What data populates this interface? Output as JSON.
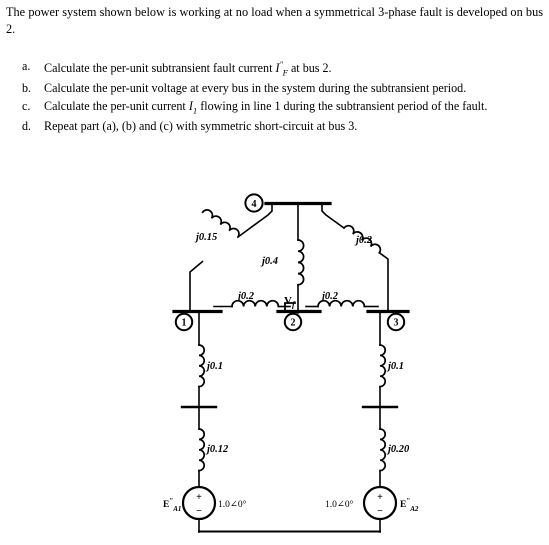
{
  "problem": {
    "intro_line1": "The power system shown below is working at no load when a symmetrical 3-phase fault is",
    "intro_line2": "developed on bus 2.",
    "questions": [
      {
        "label": "a.",
        "pre": "Calculate the per-unit subtransient fault current",
        "symbol": "I",
        "symbol_sup": "\"",
        "symbol_sub": "F",
        "post": "at bus 2."
      },
      {
        "label": "b.",
        "pre": "Calculate the per-unit voltage at every bus in the system during the subtransient period.",
        "symbol": "",
        "symbol_sup": "",
        "symbol_sub": "",
        "post": ""
      },
      {
        "label": "c.",
        "pre": "Calculate the per-unit current",
        "symbol": "I",
        "symbol_sup": "",
        "symbol_sub": "1",
        "post": "flowing in line 1 during the subtransient period of the fault."
      },
      {
        "label": "d.",
        "pre": "Repeat part (a), (b) and (c) with symmetric short-circuit at bus 3.",
        "symbol": "",
        "symbol_sup": "",
        "symbol_sub": "",
        "post": ""
      }
    ]
  },
  "diagram": {
    "title": "one-line power system diagram",
    "buses": [
      {
        "id": "bus-1",
        "number": "1"
      },
      {
        "id": "bus-2",
        "number": "2"
      },
      {
        "id": "bus-3",
        "number": "3"
      },
      {
        "id": "bus-4",
        "number": "4"
      }
    ],
    "impedances": [
      {
        "id": "line-4-1",
        "label": "j0.15",
        "desc": "transmission line bus 4 to bus 1"
      },
      {
        "id": "line-4-2",
        "label": "j0.4",
        "desc": "transmission line bus 4 to bus 2"
      },
      {
        "id": "line-4-3",
        "label": "j0.2",
        "desc": "transmission line bus 4 to bus 3"
      },
      {
        "id": "line-1-2",
        "label": "j0.2",
        "desc": "transmission line bus 1 to bus 2 (line 1)"
      },
      {
        "id": "line-2-3",
        "label": "j0.2",
        "desc": "transmission line bus 2 to bus 3"
      },
      {
        "id": "xfmr-1",
        "label": "j0.1",
        "desc": "transformer at bus 1"
      },
      {
        "id": "xfmr-2",
        "label": "j0.1",
        "desc": "transformer at bus 3"
      },
      {
        "id": "gen-1-x",
        "label": "j0.12",
        "desc": "generator 1 subtransient reactance"
      },
      {
        "id": "gen-2-x",
        "label": "j0.20",
        "desc": "generator 2 subtransient reactance"
      }
    ],
    "sources": [
      {
        "id": "source-left",
        "name": "E",
        "name_sup": "\"",
        "name_sub": "A1",
        "value": "1.0∠0°",
        "plus": "+",
        "minus": "−"
      },
      {
        "id": "source-right",
        "name": "E",
        "name_sup": "\"",
        "name_sub": "A2",
        "value": "1.0∠0°",
        "plus": "+",
        "minus": "−"
      }
    ],
    "fault_marker": {
      "id": "vf-label",
      "name": "V",
      "sub": "f"
    },
    "colors": {
      "ink": "#000000",
      "paper": "#ffffff"
    }
  }
}
